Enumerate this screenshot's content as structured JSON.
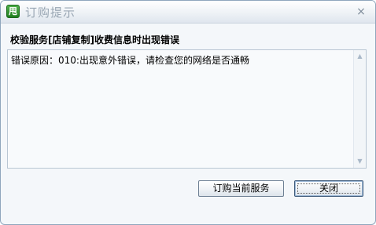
{
  "window": {
    "title": "订购提示",
    "app_logo_text": "甩",
    "close_glyph": "×"
  },
  "heading": "校验服务[店铺复制]收费信息时出现错误",
  "message": "错误原因：010:出现意外错误，请检查您的网络是否通畅",
  "scrollbar": {
    "up_glyph": "▲",
    "down_glyph": "▼"
  },
  "buttons": {
    "subscribe_label": "订购当前服务",
    "close_label": "关闭"
  },
  "colors": {
    "app_logo": "#2f9a2c",
    "title_text": "#9aa7b4",
    "dialog_background": "#f4f7fa",
    "border": "#8fa6bd"
  },
  "icons": {
    "app_logo": "app-logo-icon",
    "close": "close-icon",
    "scroll_up": "scroll-up-arrow-icon",
    "scroll_down": "scroll-down-arrow-icon"
  }
}
